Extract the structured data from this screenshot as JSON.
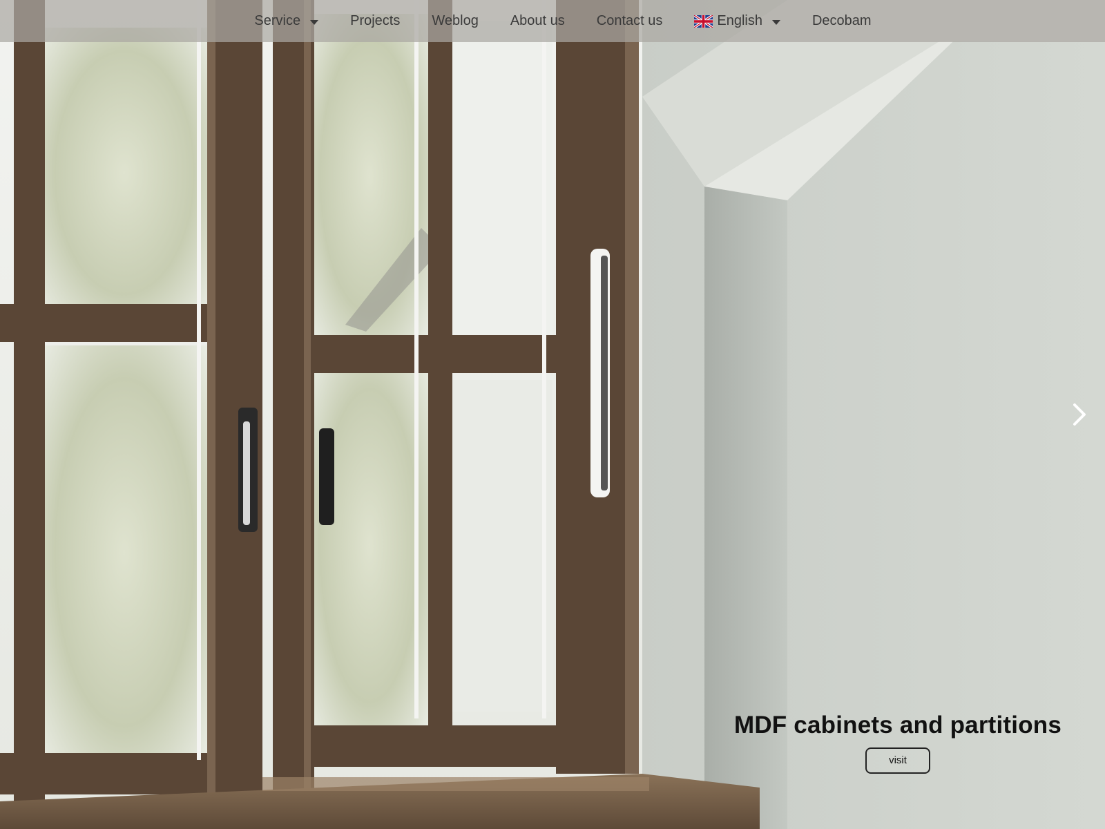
{
  "nav": {
    "items": [
      {
        "label": "Service",
        "has_dropdown": true
      },
      {
        "label": "Projects",
        "has_dropdown": false
      },
      {
        "label": "Weblog",
        "has_dropdown": false
      },
      {
        "label": "About us",
        "has_dropdown": false
      },
      {
        "label": "Contact us",
        "has_dropdown": false
      },
      {
        "label": "English",
        "has_dropdown": true,
        "icon": "uk-flag-icon"
      },
      {
        "label": "Decobam",
        "has_dropdown": false
      }
    ]
  },
  "slide": {
    "title": "MDF cabinets and partitions",
    "button_label": "visit",
    "next_icon": "chevron-right-icon"
  },
  "colors": {
    "frame_wood": "#5a4636",
    "wall": "#c9cec8",
    "navbar_bg": "#aaa8a2",
    "text_dark": "#111111"
  }
}
